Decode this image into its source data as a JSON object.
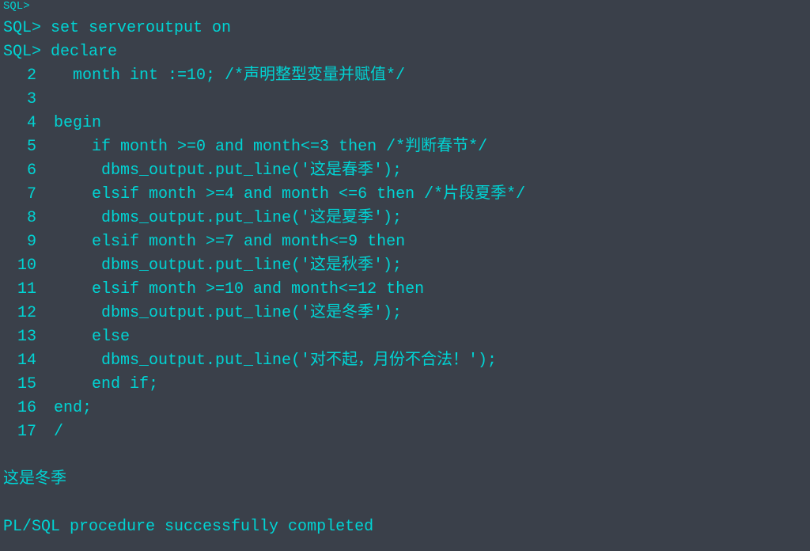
{
  "top_partial": "SQL>",
  "prompt_lines": [
    {
      "prompt": "SQL> ",
      "code": "set serveroutput on"
    },
    {
      "prompt": "SQL> ",
      "code": "declare"
    }
  ],
  "numbered_lines": [
    {
      "num": "2",
      "code": "   month int :=10; /*声明整型变量并赋值*/"
    },
    {
      "num": "3",
      "code": ""
    },
    {
      "num": "4",
      "code": " begin"
    },
    {
      "num": "5",
      "code": "     if month >=0 and month<=3 then /*判断春节*/"
    },
    {
      "num": "6",
      "code": "      dbms_output.put_line('这是春季');"
    },
    {
      "num": "7",
      "code": "     elsif month >=4 and month <=6 then /*片段夏季*/"
    },
    {
      "num": "8",
      "code": "      dbms_output.put_line('这是夏季');"
    },
    {
      "num": "9",
      "code": "     elsif month >=7 and month<=9 then"
    },
    {
      "num": "10",
      "code": "      dbms_output.put_line('这是秋季');"
    },
    {
      "num": "11",
      "code": "     elsif month >=10 and month<=12 then"
    },
    {
      "num": "12",
      "code": "      dbms_output.put_line('这是冬季');"
    },
    {
      "num": "13",
      "code": "     else"
    },
    {
      "num": "14",
      "code": "      dbms_output.put_line('对不起，月份不合法！');"
    },
    {
      "num": "15",
      "code": "     end if;"
    },
    {
      "num": "16",
      "code": " end;"
    },
    {
      "num": "17",
      "code": " /"
    }
  ],
  "output_lines": [
    "",
    "这是冬季",
    "",
    "PL/SQL procedure successfully completed"
  ]
}
